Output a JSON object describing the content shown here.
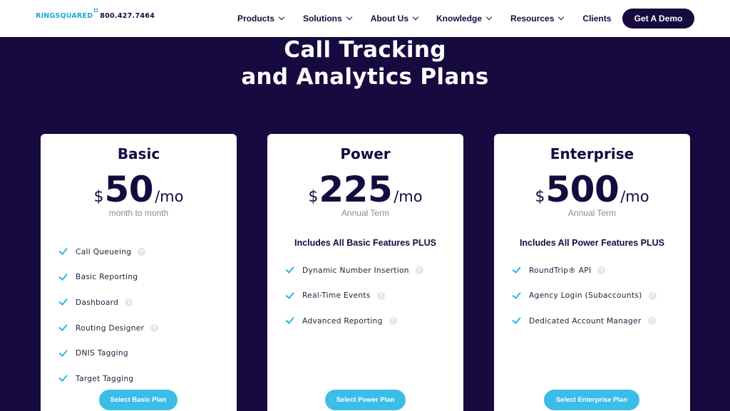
{
  "header": {
    "logo_text": "RINGSQUARED",
    "phone": "800.427.7464",
    "nav": [
      {
        "label": "Products",
        "dropdown": true
      },
      {
        "label": "Solutions",
        "dropdown": true
      },
      {
        "label": "About Us",
        "dropdown": true
      },
      {
        "label": "Knowledge",
        "dropdown": true
      },
      {
        "label": "Resources",
        "dropdown": true
      },
      {
        "label": "Clients",
        "dropdown": false
      }
    ],
    "cta_label": "Get A Demo"
  },
  "hero": {
    "title_line1": "Call Tracking",
    "title_line2": "and Analytics Plans"
  },
  "plans": [
    {
      "name": "Basic",
      "currency": "$",
      "amount": "50",
      "period": "/mo",
      "term": "month to month",
      "includes": "",
      "features": [
        "Call Queueing",
        "Basic Reporting",
        "Dashboard",
        "Routing Designer",
        "DNIS Tagging",
        "Target Tagging"
      ],
      "button": "Select Basic Plan"
    },
    {
      "name": "Power",
      "currency": "$",
      "amount": "225",
      "period": "/mo",
      "term": "Annual Term",
      "includes": "Includes All Basic Features PLUS",
      "features": [
        "Dynamic Number Insertion",
        "Real-Time Events",
        "Advanced Reporting"
      ],
      "button": "Select Power Plan"
    },
    {
      "name": "Enterprise",
      "currency": "$",
      "amount": "500",
      "period": "/mo",
      "term": "Annual Term",
      "includes": "Includes All Power Features PLUS",
      "features": [
        "RoundTrip® API",
        "Agency Login (Subaccounts)",
        "Dedicated Account Manager"
      ],
      "button": "Select Enterprise Plan"
    }
  ],
  "help_icon_glyph": "?",
  "colors": {
    "brand_navy": "#160a3f",
    "accent_blue": "#3bbde8",
    "check_blue": "#2ab8e4"
  }
}
